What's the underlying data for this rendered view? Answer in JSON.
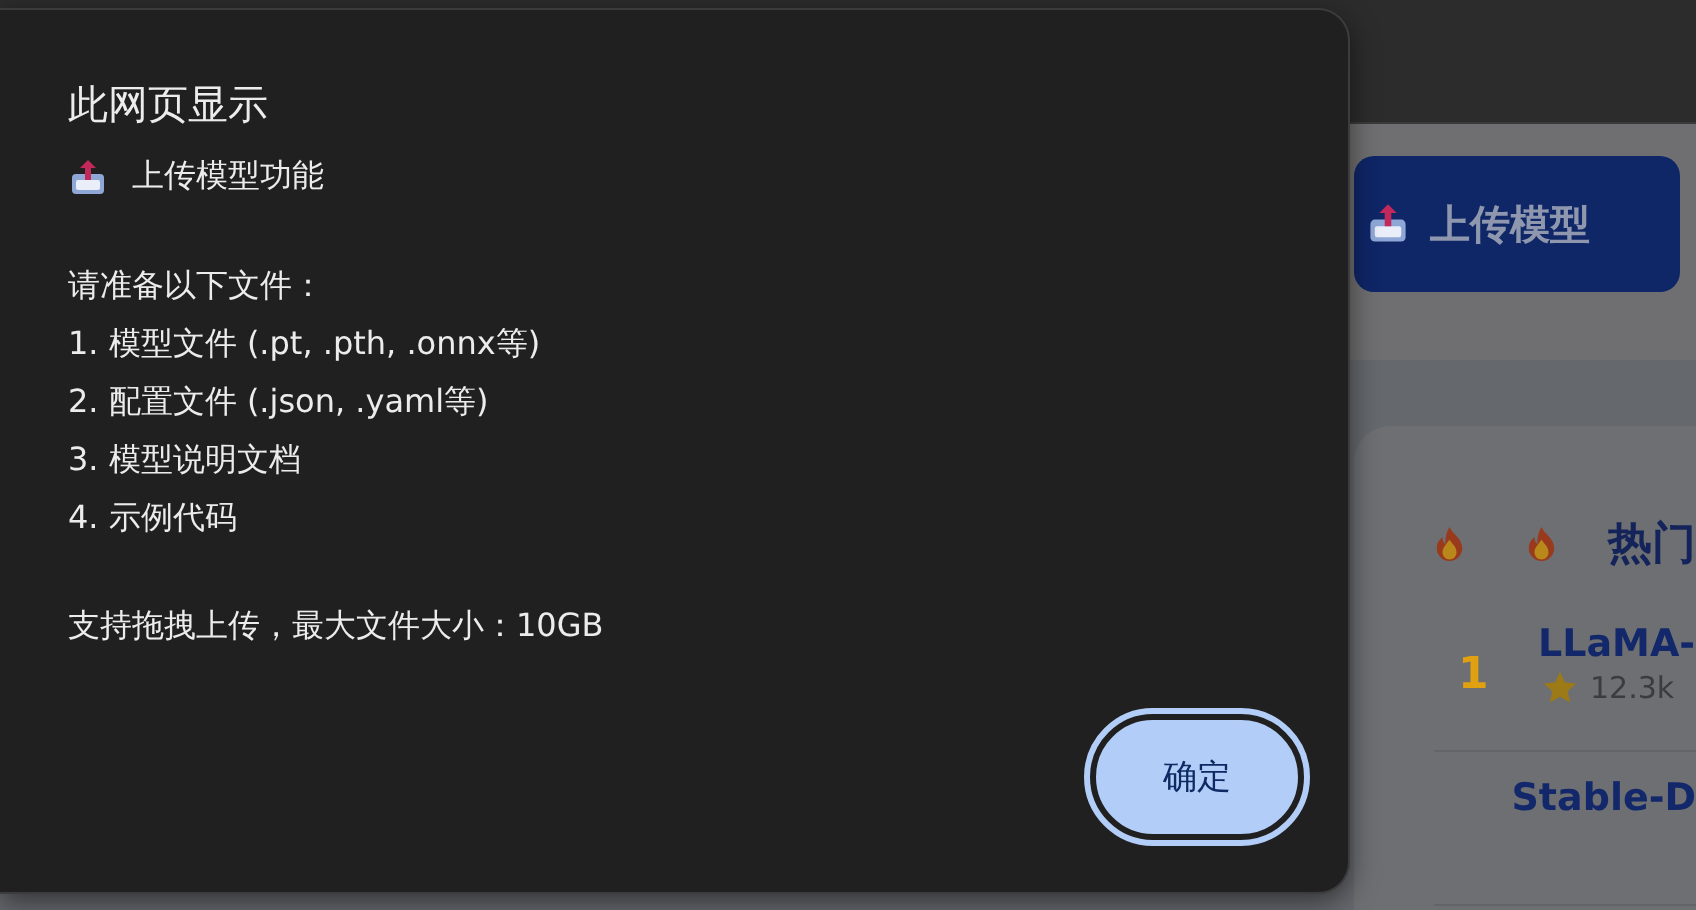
{
  "dialog": {
    "title": "此网页显示",
    "heading": "上传模型功能",
    "lines": [
      "请准备以下文件：",
      "1. 模型文件 (.pt, .pth, .onnx等)",
      "2. 配置文件 (.json, .yaml等)",
      "3. 模型说明文档",
      "4. 示例代码"
    ],
    "note": "支持拖拽上传，最大文件大小：10GB",
    "button": "确定"
  },
  "page": {
    "upload_button": "上传模型",
    "section_title": "热门",
    "models": [
      {
        "rank": "1",
        "name": "LLaMA-",
        "stars": "12.3k"
      },
      {
        "name": "Stable-D"
      }
    ]
  }
}
